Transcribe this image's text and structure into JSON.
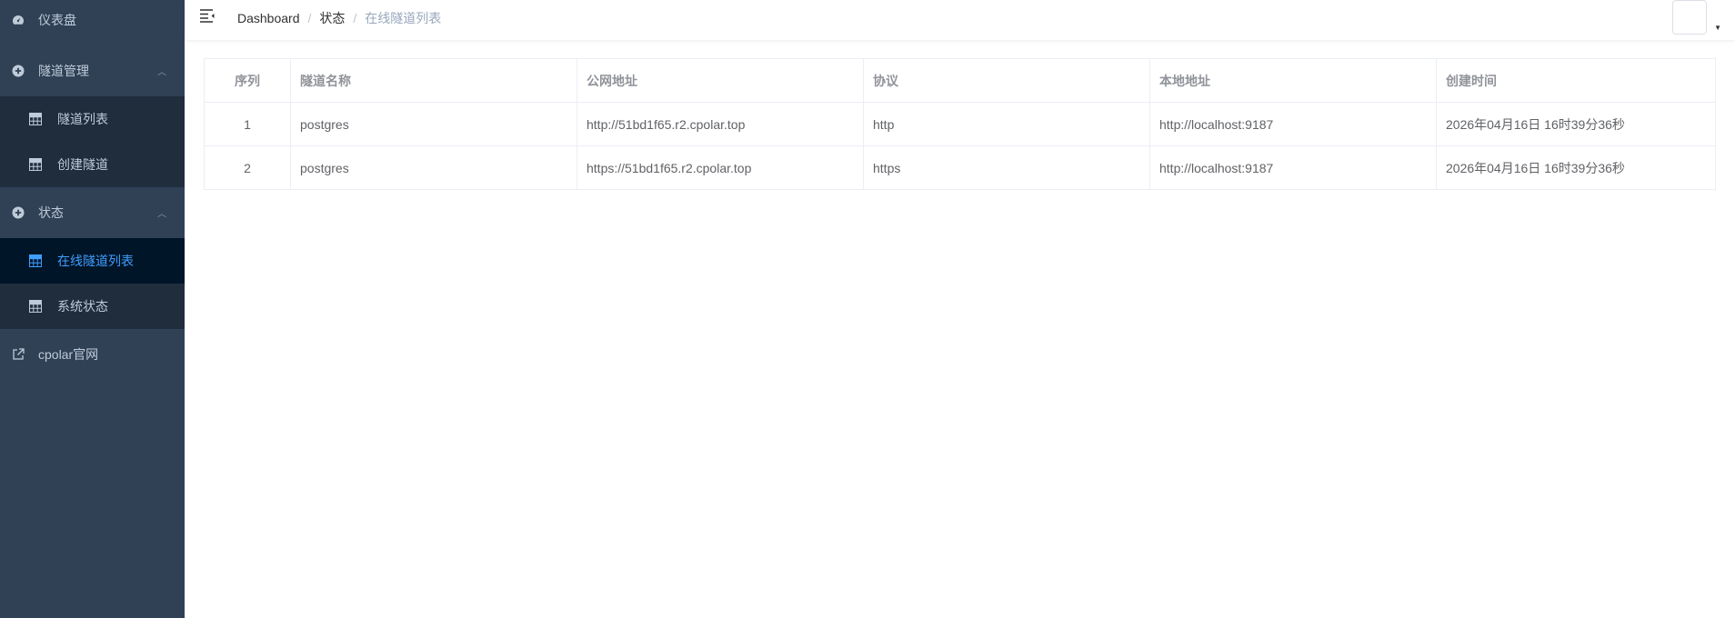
{
  "sidebar": {
    "dashboard": "仪表盘",
    "tunnel_mgmt": "隧道管理",
    "tunnel_list": "隧道列表",
    "create_tunnel": "创建隧道",
    "status": "状态",
    "online_tunnels": "在线隧道列表",
    "system_status": "系统状态",
    "website": "cpolar官网"
  },
  "breadcrumb": {
    "home": "Dashboard",
    "section": "状态",
    "current": "在线隧道列表",
    "sep": "/"
  },
  "table": {
    "headers": [
      "序列",
      "隧道名称",
      "公网地址",
      "协议",
      "本地地址",
      "创建时间"
    ],
    "rows": [
      [
        "1",
        "postgres",
        "http://51bd1f65.r2.cpolar.top",
        "http",
        "http://localhost:9187",
        "2026年04月16日 16时39分36秒"
      ],
      [
        "2",
        "postgres",
        "https://51bd1f65.r2.cpolar.top",
        "https",
        "http://localhost:9187",
        "2026年04月16日 16时39分36秒"
      ]
    ]
  },
  "colors": {
    "sidebar_bg": "#304156",
    "submenu_bg": "#1f2d3d",
    "active_bg": "#001528",
    "active_text": "#409eff"
  }
}
